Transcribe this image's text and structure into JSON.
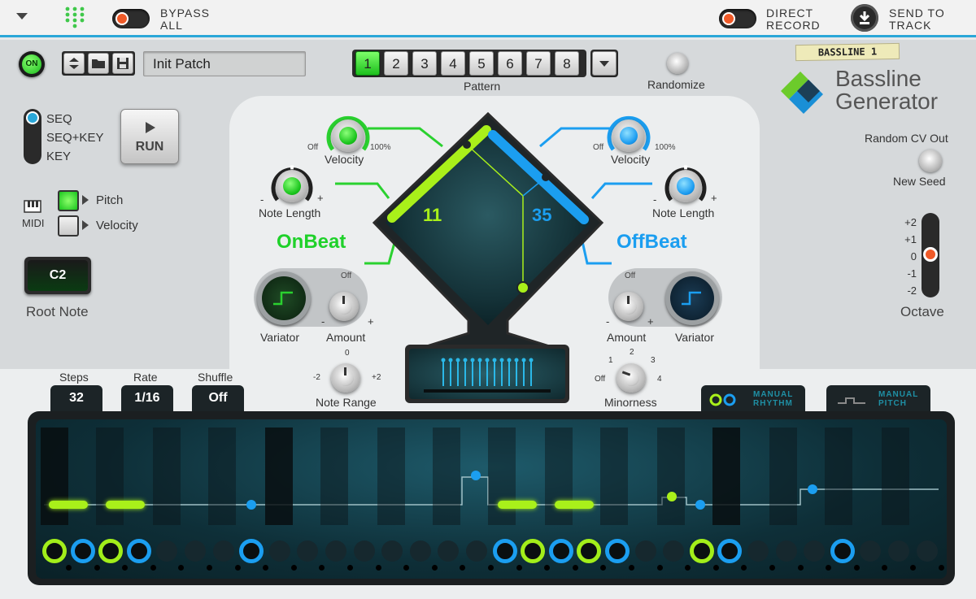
{
  "topbar": {
    "bypass_label_1": "BYPASS",
    "bypass_label_2": "ALL",
    "direct_label_1": "DIRECT",
    "direct_label_2": "RECORD",
    "send_label_1": "SEND TO",
    "send_label_2": "TRACK"
  },
  "device": {
    "on_label": "ON",
    "patch_name": "Init Patch",
    "tape_label": "BASSLINE 1",
    "brand_1": "Bassline",
    "brand_2": "Generator"
  },
  "pattern": {
    "buttons": [
      "1",
      "2",
      "3",
      "4",
      "5",
      "6",
      "7",
      "8"
    ],
    "selected": "1",
    "label": "Pattern",
    "randomize_label": "Randomize"
  },
  "left": {
    "mode_options": [
      "SEQ",
      "SEQ+KEY",
      "KEY"
    ],
    "mode_selected": "SEQ",
    "run_label": "RUN",
    "midi_label": "MIDI",
    "pitch_label": "Pitch",
    "velocity_label": "Velocity",
    "root_note_value": "C2",
    "root_note_label": "Root Note"
  },
  "onbeat": {
    "title": "OnBeat",
    "velocity_label": "Velocity",
    "off_label": "Off",
    "max_label": "100%",
    "note_length_label": "Note Length",
    "minus": "-",
    "plus": "+",
    "variator_label": "Variator",
    "amount_label": "Amount",
    "value": "11"
  },
  "offbeat": {
    "title": "OffBeat",
    "velocity_label": "Velocity",
    "off_label": "Off",
    "max_label": "100%",
    "note_length_label": "Note Length",
    "minus": "-",
    "plus": "+",
    "variator_label": "Variator",
    "amount_label": "Amount",
    "value": "35"
  },
  "note_range": {
    "label": "Note Range",
    "min": "-2",
    "zero": "0",
    "max": "+2"
  },
  "minorness": {
    "label": "Minorness",
    "t_off": "Off",
    "t1": "1",
    "t2": "2",
    "t3": "3",
    "t4": "4"
  },
  "right": {
    "random_cv_label": "Random CV Out",
    "new_seed_label": "New Seed",
    "octave_ticks": [
      "+2",
      "+1",
      "0",
      "-1",
      "-2"
    ],
    "octave_label": "Octave",
    "octave_value": 0
  },
  "seq_controls": {
    "steps_label": "Steps",
    "steps_value": "32",
    "rate_label": "Rate",
    "rate_value": "1/16",
    "shuffle_label": "Shuffle",
    "shuffle_value": "Off",
    "manual_rhythm_1": "MANUAL",
    "manual_rhythm_2": "RHYTHM",
    "manual_pitch_1": "MANUAL",
    "manual_pitch_2": "PITCH"
  },
  "colors": {
    "onbeat": "#1fd12a",
    "offbeat": "#1b9ef0",
    "accent": "#2aa7d8",
    "step_green": "#a9f01a"
  }
}
